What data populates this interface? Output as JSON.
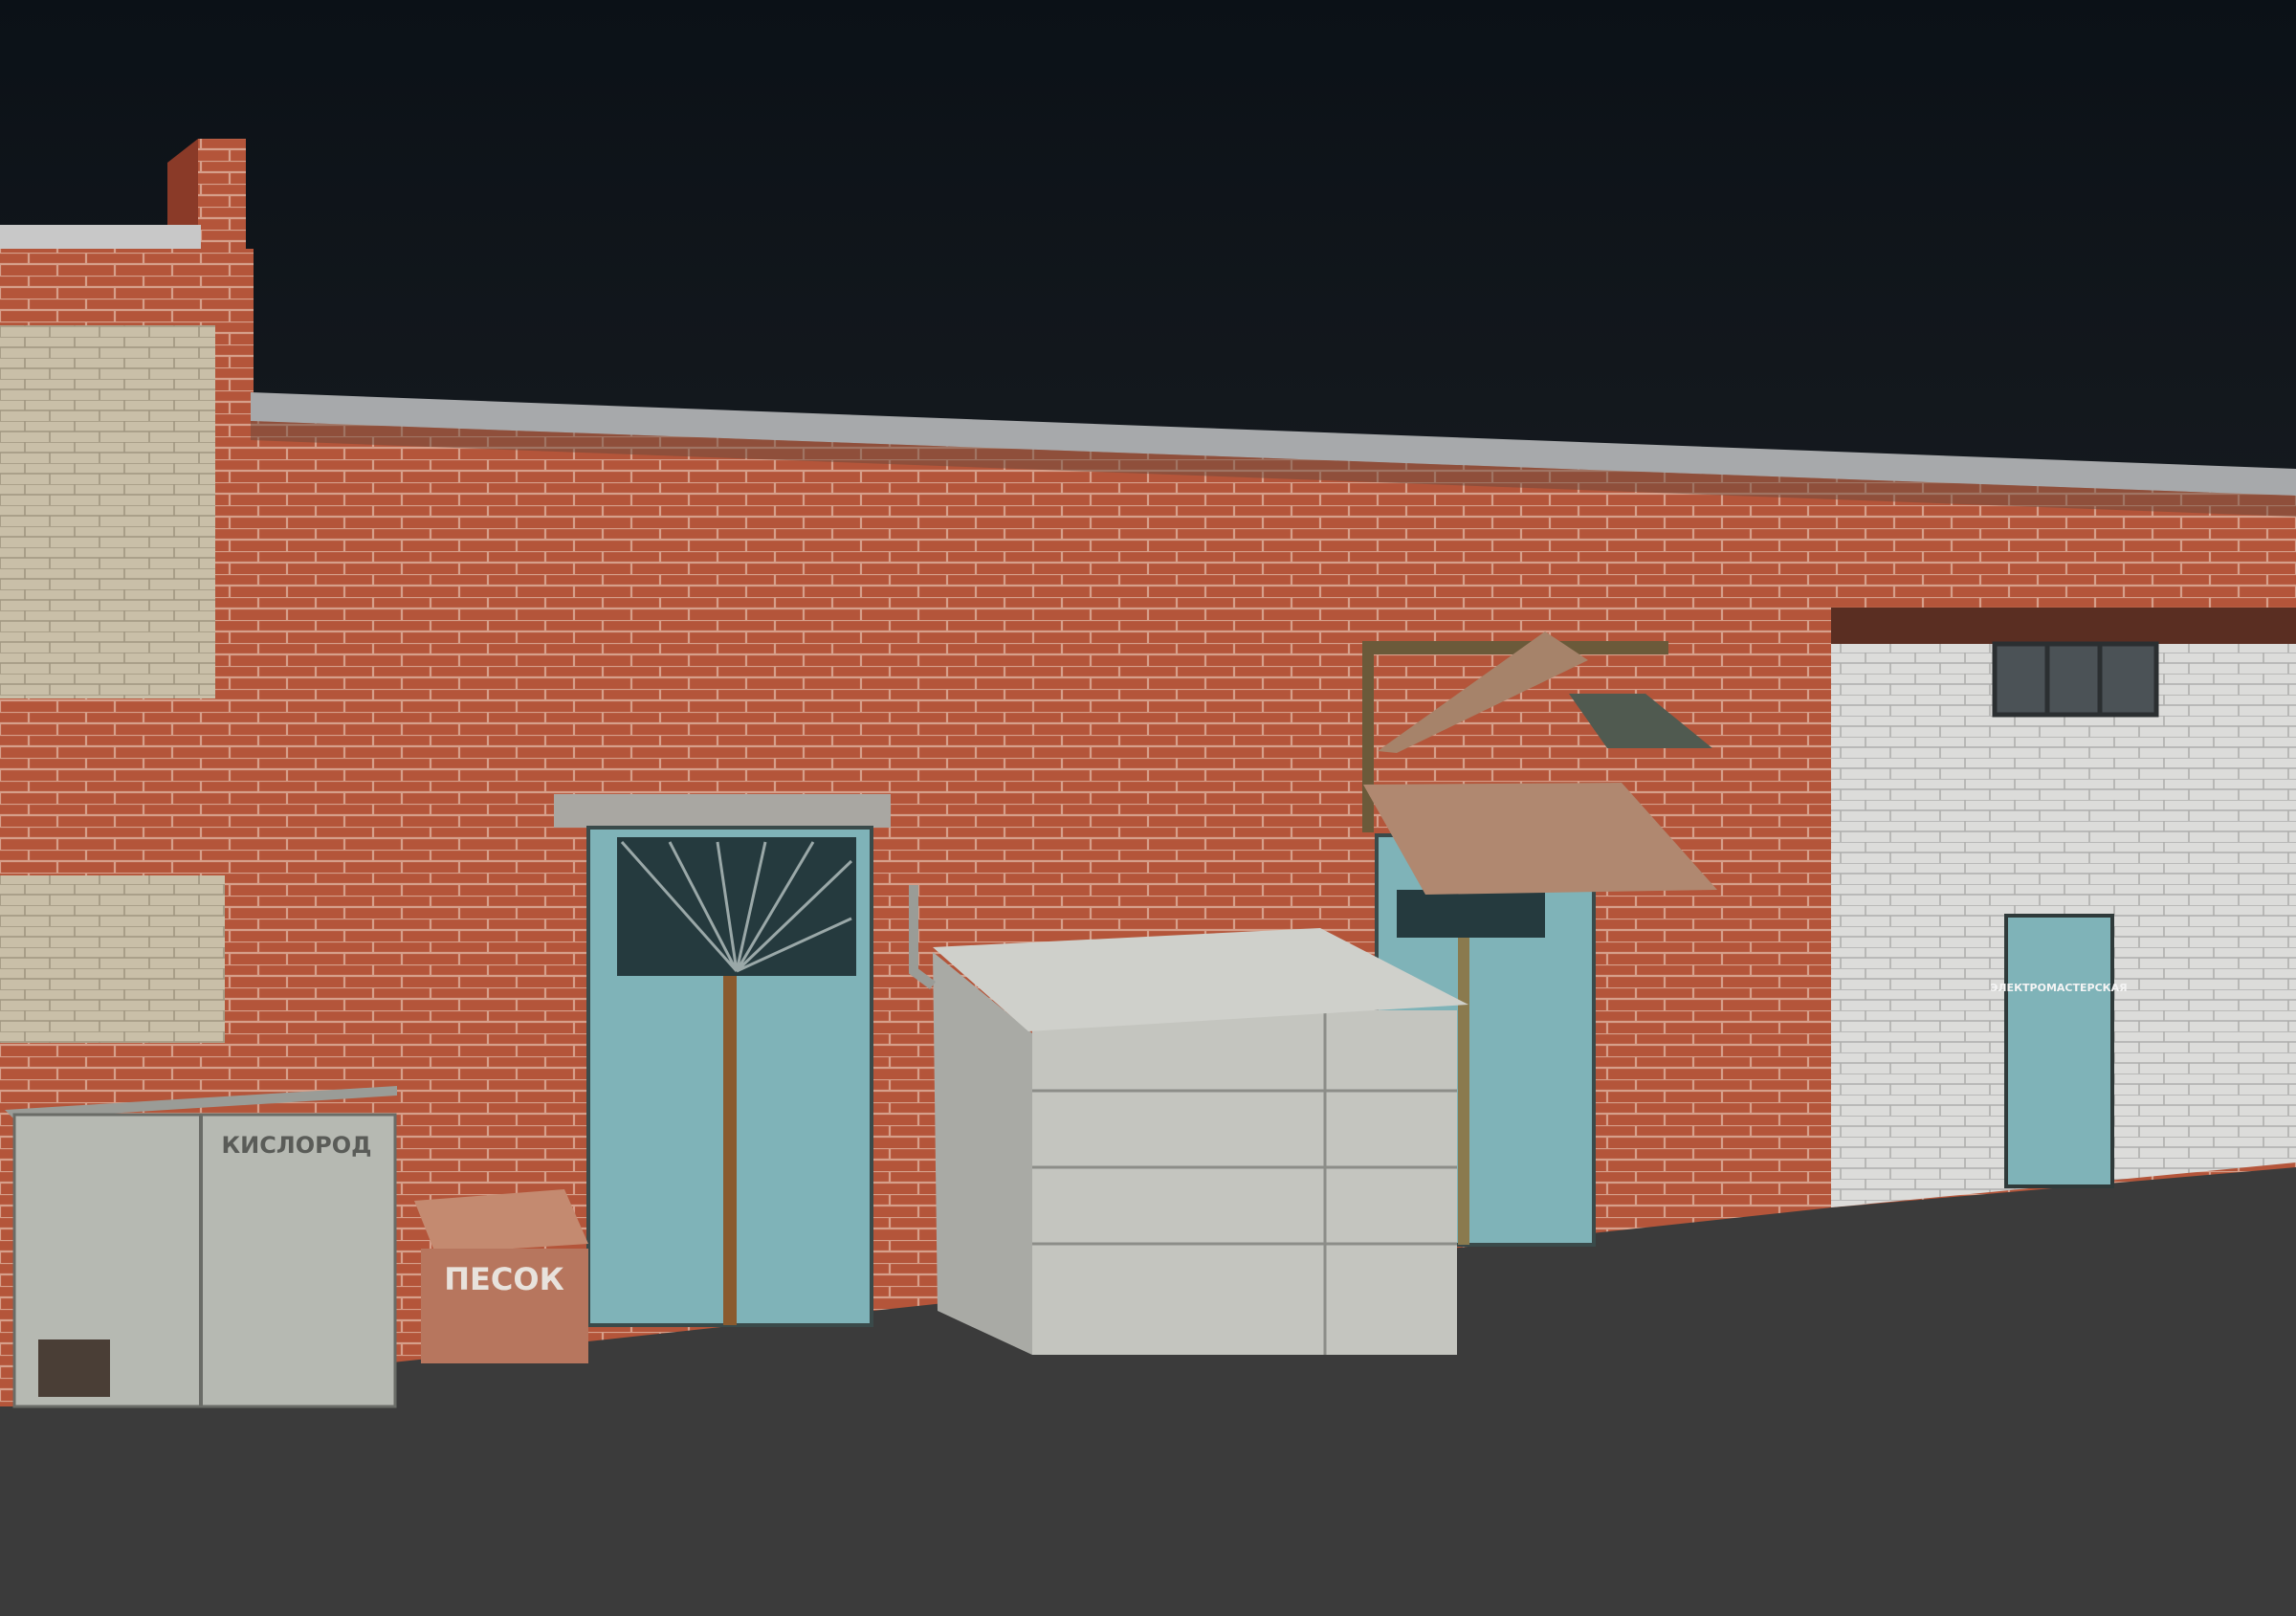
{
  "scene": {
    "description_label": "3D model render of industrial brick building facade",
    "signs": {
      "oxygen_cabinet": "КИСЛОРОД",
      "sand_box": "ПЕСОК",
      "workshop_door": "ЭЛЕКТРОМАСТЕРСКАЯ"
    }
  },
  "colors": {
    "sky_top": "#0b1117",
    "sky_bottom": "#2b2c2f",
    "ground": "#3b3b3b",
    "brick_red": "#b4553a",
    "brick_white": "#d8d8d6",
    "door_blue": "#7fb3b8",
    "metal_gray": "#b9bbb4"
  }
}
